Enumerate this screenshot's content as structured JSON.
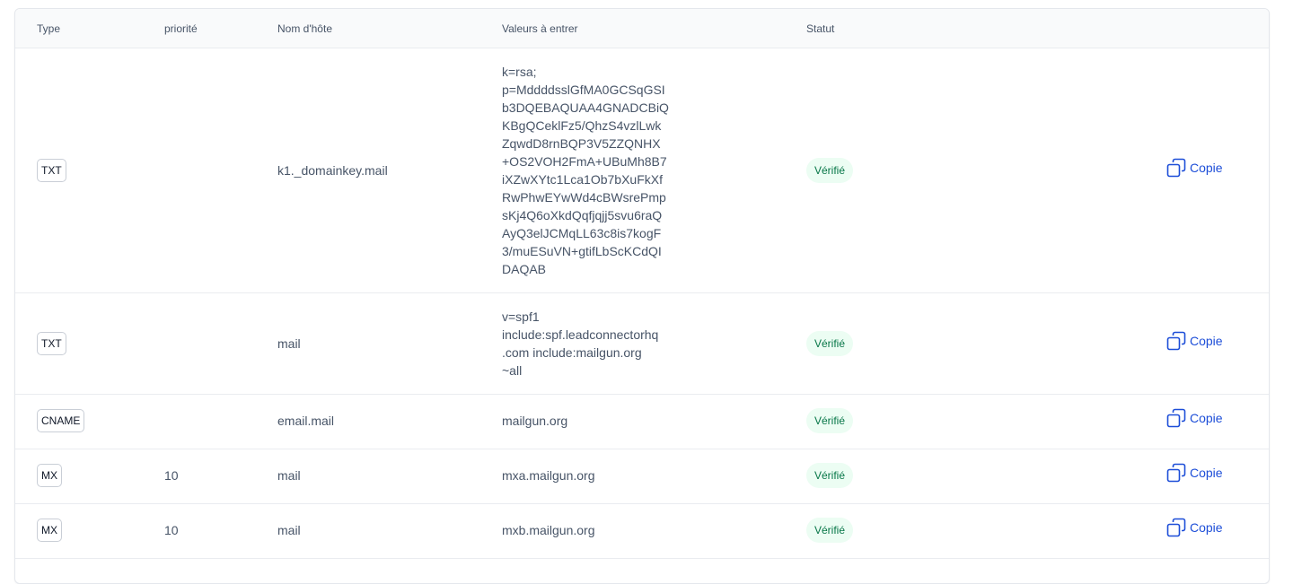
{
  "table": {
    "headers": {
      "type": "Type",
      "priority": "priorité",
      "hostname": "Nom d'hôte",
      "values": "Valeurs à entrer",
      "status": "Statut"
    },
    "rows": [
      {
        "type": "TXT",
        "priority": "",
        "hostname": "k1._domainkey.mail",
        "value": "k=rsa;\np=MddddsslGfMA0GCSqGSI\nb3DQEBAQUAA4GNADCBiQ\nKBgQCeklFz5/QhzS4vzlLwk\nZqwdD8rnBQP3V5ZZQNHX\n+OS2VOH2FmA+UBuMh8B7\niXZwXYtc1Lca1Ob7bXuFkXf\nRwPhwEYwWd4cBWsrePmp\nsKj4Q6oXkdQqfjqjj5svu6raQ\nAyQ3elJCMqLL63c8is7kogF\n3/muESuVN+gtifLbScKCdQI\nDAQAB",
        "status": "Vérifié",
        "copy_label": "Copie"
      },
      {
        "type": "TXT",
        "priority": "",
        "hostname": "mail",
        "value": "v=spf1\ninclude:spf.leadconnectorhq\n.com include:mailgun.org\n~all",
        "status": "Vérifié",
        "copy_label": "Copie"
      },
      {
        "type": "CNAME",
        "priority": "",
        "hostname": "email.mail",
        "value": "mailgun.org",
        "status": "Vérifié",
        "copy_label": "Copie"
      },
      {
        "type": "MX",
        "priority": "10",
        "hostname": "mail",
        "value": "mxa.mailgun.org",
        "status": "Vérifié",
        "copy_label": "Copie"
      },
      {
        "type": "MX",
        "priority": "10",
        "hostname": "mail",
        "value": "mxb.mailgun.org",
        "status": "Vérifié",
        "copy_label": "Copie"
      }
    ]
  },
  "icons": {
    "copy": "copy-icon"
  },
  "colors": {
    "accent": "#1d4ed8",
    "status_bg": "#ecfdf3",
    "status_text": "#067647"
  }
}
